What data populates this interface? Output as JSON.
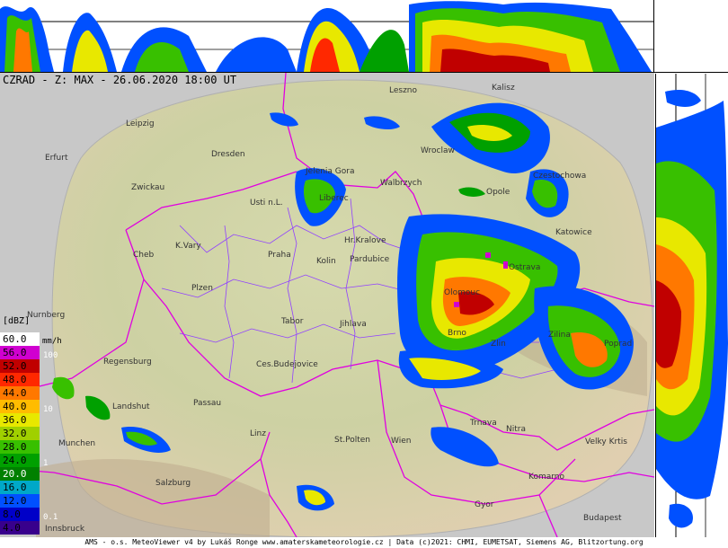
{
  "header": {
    "title": "CZRAD - Z: MAX - 26.06.2020 18:00 UT"
  },
  "legend": {
    "unit": "[dBZ]",
    "rate_unit": "mm/h",
    "rows": [
      {
        "label": "60.0",
        "color": "#ffffff",
        "text_color": "#000000"
      },
      {
        "label": "56.0",
        "color": "#d000d0",
        "text_color": "#000000"
      },
      {
        "label": "52.0",
        "color": "#c00000",
        "text_color": "#000000"
      },
      {
        "label": "48.0",
        "color": "#ff2800",
        "text_color": "#000000"
      },
      {
        "label": "44.0",
        "color": "#ff7800",
        "text_color": "#000000"
      },
      {
        "label": "40.0",
        "color": "#ffbc00",
        "text_color": "#000000"
      },
      {
        "label": "36.0",
        "color": "#e8e800",
        "text_color": "#000000"
      },
      {
        "label": "32.0",
        "color": "#a0d000",
        "text_color": "#000000"
      },
      {
        "label": "28.0",
        "color": "#38c000",
        "text_color": "#000000"
      },
      {
        "label": "24.0",
        "color": "#00a000",
        "text_color": "#000000"
      },
      {
        "label": "20.0",
        "color": "#008000",
        "text_color": "#ffffff"
      },
      {
        "label": "16.0",
        "color": "#00a8c8",
        "text_color": "#000000"
      },
      {
        "label": "12.0",
        "color": "#0050ff",
        "text_color": "#000000"
      },
      {
        "label": "8.0",
        "color": "#0000c8",
        "text_color": "#000000"
      },
      {
        "label": "4.0",
        "color": "#38008c",
        "text_color": "#000000"
      }
    ],
    "rates": [
      "100",
      "10",
      "1",
      "0.1"
    ]
  },
  "cities": [
    "Leszno",
    "Kalisz",
    "Leipzig",
    "Wroclaw",
    "Erfurt",
    "Dresden",
    "Jelenia Gora",
    "Walbrzych",
    "Opole",
    "Czestochowa",
    "Zwickau",
    "Usti n.L.",
    "Liberec",
    "Katowice",
    "Cheb",
    "K.Vary",
    "Hr.Kralove",
    "Pardubice",
    "Praha",
    "Kolin",
    "Plzen",
    "Nurnberg",
    "Tabor",
    "Jihlava",
    "Regensburg",
    "Ces.Budejovice",
    "Brno",
    "Zlin",
    "Zilina",
    "Landshut",
    "Passau",
    "Trnava",
    "Nitra",
    "Linz",
    "St.Polten",
    "Wien",
    "Munchen",
    "Salzburg",
    "Komarno",
    "Gyor",
    "Budapest",
    "Innsbruck",
    "Velky Krtis",
    "Poprad",
    "Ostrava",
    "Olomouc"
  ],
  "footer": {
    "text": "AMS - o.s. MeteoViewer v4 by Lukáš Ronge www.amaterskameteorologie.cz | Data (c)2021: CHMI, EUMETSAT, Siemens AG, Blitzortung.org"
  },
  "colors": {
    "background": "#c8c8c8",
    "border_line": "#e000e0",
    "region_line": "#9040ff",
    "terrain": "#d8d2a8"
  }
}
